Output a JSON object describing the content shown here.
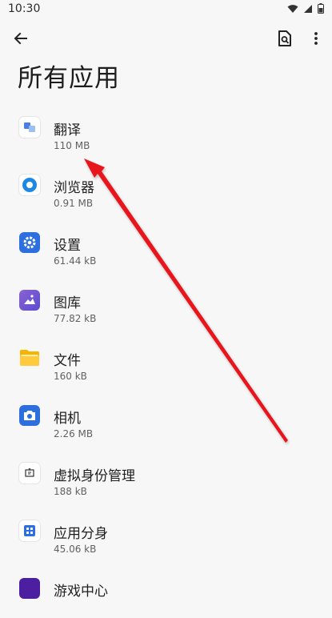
{
  "status_bar": {
    "time": "10:30"
  },
  "header": {
    "title": "所有应用"
  },
  "apps": [
    {
      "name": "翻译",
      "size": "110 MB"
    },
    {
      "name": "浏览器",
      "size": "0.91 MB"
    },
    {
      "name": "设置",
      "size": "61.44 kB"
    },
    {
      "name": "图库",
      "size": "77.82 kB"
    },
    {
      "name": "文件",
      "size": "160 kB"
    },
    {
      "name": "相机",
      "size": "2.26 MB"
    },
    {
      "name": "虚拟身份管理",
      "size": "188 kB"
    },
    {
      "name": "应用分身",
      "size": "45.06 kB"
    },
    {
      "name": "游戏中心",
      "size": ""
    }
  ],
  "icons": {
    "back": "arrow-left-icon",
    "search": "search-document-icon",
    "more": "more-vertical-icon"
  },
  "colors": {
    "accent": "#2e6fe0",
    "arrow": "#e8171b"
  }
}
